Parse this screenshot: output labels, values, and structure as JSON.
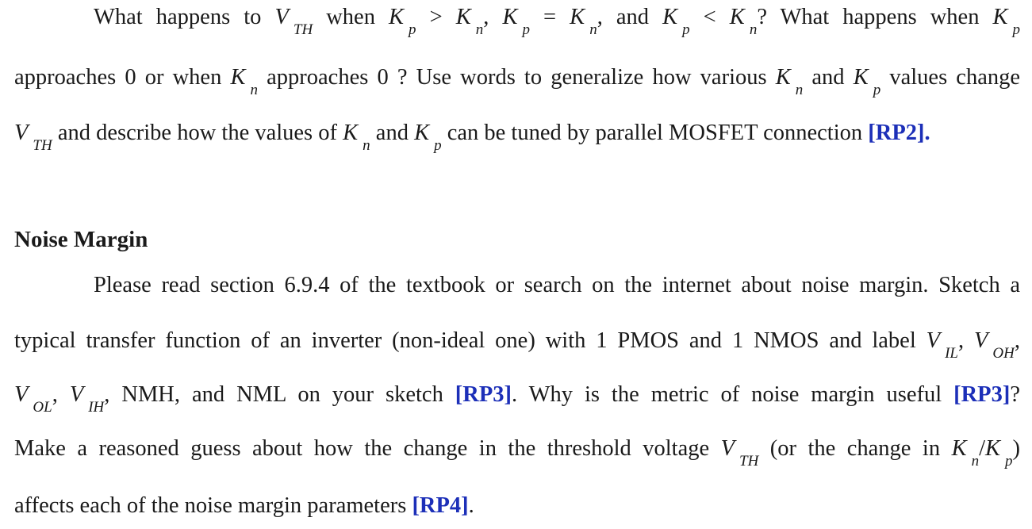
{
  "paragraph1": {
    "line1": {
      "t1": "What happens to ",
      "V": "V",
      "TH": "TH",
      "t2": " when ",
      "K": "K",
      "p": "p",
      "n": "n",
      "gt": " > ",
      "eq": " = ",
      "lt": " < ",
      "comma": ",",
      "and": " and ",
      "t3": "? What happens when "
    },
    "line2": {
      "t1": "approaches 0 or when ",
      "t2": " approaches 0 ? Use words to generalize how various ",
      "t3": " and ",
      "t4": " values change"
    },
    "line3": {
      "t1": " and describe how the values of ",
      "t2": " and ",
      "t3": " can be tuned by parallel MOSFET connection ",
      "rp": "[RP2]."
    }
  },
  "section": {
    "heading": "Noise Margin",
    "line1": "Please read section 6.9.4 of the textbook or search on the internet about noise margin. Sketch a",
    "line2": {
      "t1": "typical transfer function of an inverter (non-ideal one) with 1 PMOS and 1 NMOS and label ",
      "IL": "IL",
      "OH": "OH",
      "OL": "OL",
      "IH": "IH"
    },
    "line3": {
      "t1": " NMH, and NML on your sketch ",
      "rp3": "[RP3]",
      "t2": ". Why is the metric of noise margin useful ",
      "t3": "?"
    },
    "line4": {
      "t1": "Make a reasoned guess about how the change in the threshold voltage ",
      "t2": " (or the change in ",
      "slash": "/",
      "t3": ")"
    },
    "line5": {
      "t1": "affects each of the noise margin parameters ",
      "rp4": "[RP4]",
      "t2": "."
    }
  },
  "colors": {
    "reference_tag": "#1c2fb8",
    "text": "#1a1a1a"
  }
}
